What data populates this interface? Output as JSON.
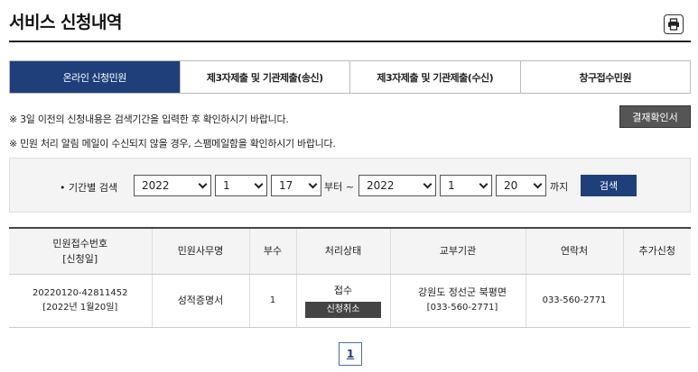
{
  "page": {
    "title": "서비스 신청내역"
  },
  "icons": {
    "print": "print-icon",
    "caret": "chevron-down-icon"
  },
  "tabs": [
    {
      "label": "온라인 신청민원",
      "active": true
    },
    {
      "label": "제3자제출 및 기관제출(송신)",
      "active": false
    },
    {
      "label": "제3자제출 및 기관제출(수신)",
      "active": false
    },
    {
      "label": "창구접수민원",
      "active": false
    }
  ],
  "notices": {
    "line1": "※ 3일 이전의 신청내용은 검색기간을 입력한 후 확인하시기 바랍니다.",
    "line2": "※ 민원 처리 알림 메일이 수신되지 않을 경우, 스팸메일함을 확인하시기 바랍니다."
  },
  "confirm_button": "결재확인서",
  "search": {
    "label": "• 기간별 검색",
    "from_year": "2022",
    "from_month": "1",
    "from_day": "17",
    "from_suffix": "부터 ~",
    "to_year": "2022",
    "to_month": "1",
    "to_day": "20",
    "to_suffix": "까지",
    "button": "검색"
  },
  "table": {
    "headers": {
      "receipt_no_line1": "민원접수번호",
      "receipt_no_line2": "[신청일]",
      "service": "민원사무명",
      "copies": "부수",
      "status": "처리상태",
      "agency": "교부기관",
      "contact": "연락처",
      "extra": "추가신청"
    },
    "rows": [
      {
        "receipt_no": "20220120-42811452",
        "date": "[2022년 1월20일]",
        "service": "성적증명서",
        "copies": "1",
        "status": "접수",
        "cancel": "신청취소",
        "agency_name": "강원도 정선군 북평면",
        "agency_phone": "[033-560-2771]",
        "contact": "033-560-2771",
        "extra": ""
      }
    ]
  },
  "pagination": {
    "current": "1"
  },
  "colors": {
    "accent": "#1e3f7a",
    "dark_button": "#555555",
    "header_bg": "#f4f4f4"
  }
}
